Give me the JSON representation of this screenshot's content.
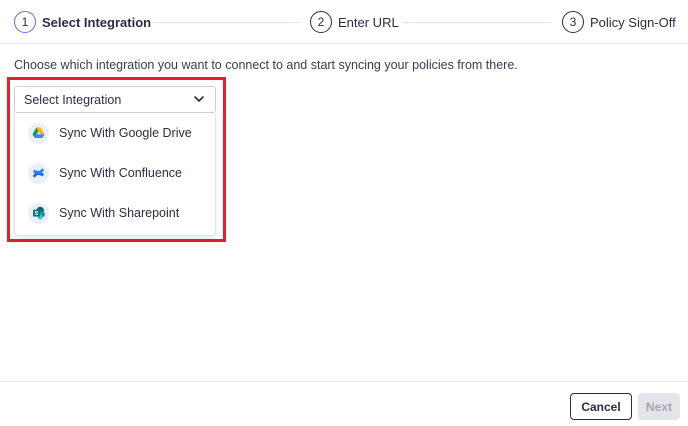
{
  "stepper": {
    "steps": [
      {
        "number": "1",
        "label": "Select Integration",
        "active": true
      },
      {
        "number": "2",
        "label": "Enter URL",
        "active": false
      },
      {
        "number": "3",
        "label": "Policy Sign-Off",
        "active": false
      }
    ]
  },
  "main": {
    "instruction": "Choose which integration you want to connect to and start syncing your policies from there.",
    "select": {
      "value": "Select Integration",
      "icon": "chevron-down-icon",
      "options": [
        {
          "label": "Sync With Google Drive",
          "icon": "google-drive-icon"
        },
        {
          "label": "Sync With Confluence",
          "icon": "confluence-icon"
        },
        {
          "label": "Sync With Sharepoint",
          "icon": "sharepoint-icon"
        }
      ]
    }
  },
  "footer": {
    "cancel_label": "Cancel",
    "next_label": "Next"
  },
  "colors": {
    "accent": "#6c63ff",
    "highlight": "#e0202a",
    "text": "#2b2d42",
    "disabled_bg": "#e4e5ea"
  }
}
